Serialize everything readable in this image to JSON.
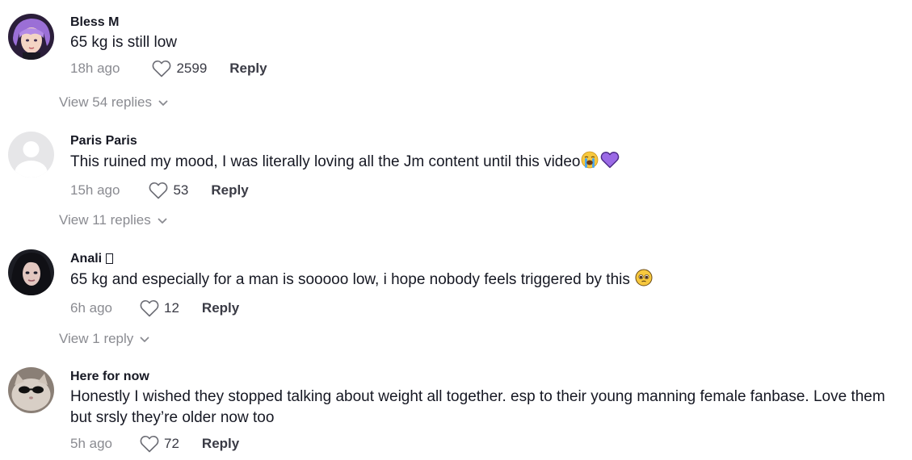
{
  "comments": [
    {
      "username": "Bless M",
      "text": "65 kg is still low",
      "time": "18h ago",
      "likes": "2599",
      "reply_label": "Reply",
      "view_replies": "View 54 replies",
      "avatar": "anime-character-purple-hair"
    },
    {
      "username": "Paris Paris",
      "text": "This ruined my mood, I was literally loving all the Jm content until this video",
      "text_emojis": [
        "loudly-crying-face",
        "purple-heart"
      ],
      "time": "15h ago",
      "likes": "53",
      "reply_label": "Reply",
      "view_replies": "View 11 replies",
      "avatar": "default-user-placeholder"
    },
    {
      "username": "Anali",
      "text": "65 kg and especially for a man is sooooo low, i hope nobody feels triggered by this",
      "text_emojis": [
        "pleading-face"
      ],
      "time": "6h ago",
      "likes": "12",
      "reply_label": "Reply",
      "view_replies": "View 1 reply",
      "avatar": "dark-hair-woman-photo"
    },
    {
      "username": "Here for now",
      "text": "Honestly I wished they stopped talking about weight all together. esp to their young manning female fanbase. Love them but srsly they’re older now too",
      "time": "5h ago",
      "likes": "72",
      "reply_label": "Reply",
      "avatar": "cat-with-sunglasses-photo"
    }
  ],
  "colors": {
    "text": "#161823",
    "muted": "#8a8b91",
    "action": "#3a3b45",
    "background": "#ffffff"
  },
  "icons": {
    "like": "heart-outline-icon",
    "expand": "chevron-down-icon"
  }
}
